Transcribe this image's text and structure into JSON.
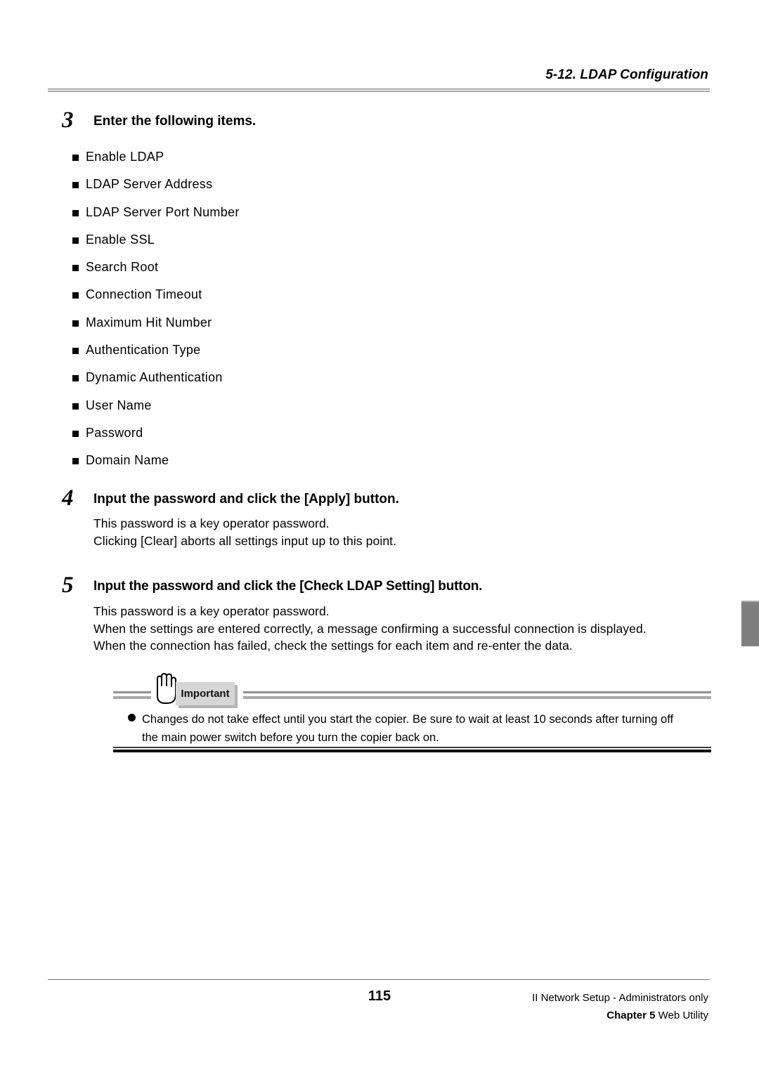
{
  "header": {
    "title": "5-12. LDAP Configuration"
  },
  "steps": [
    {
      "number": "3",
      "title": "Enter the following items."
    },
    {
      "number": "4",
      "title": "Input the password and click the [Apply] button.",
      "body_lines": [
        "This password is a key operator password.",
        "Clicking [Clear] aborts all settings input up to this point."
      ]
    },
    {
      "number": "5",
      "title": "Input the password and click the [Check LDAP Setting] button.",
      "body_lines": [
        "This password is a key operator password.",
        "When the settings are entered correctly, a message confirming a successful connection is displayed.",
        "When the connection has failed, check the settings for each item and re-enter the data."
      ]
    }
  ],
  "bullets": [
    "Enable LDAP",
    "LDAP Server Address",
    "LDAP Server Port Number",
    "Enable SSL",
    "Search Root",
    "Connection Timeout",
    "Maximum Hit Number",
    "Authentication Type",
    "Dynamic Authentication",
    "User Name",
    "Password",
    "Domain Name"
  ],
  "callout": {
    "label": "Important",
    "icon": "hand-stop-icon",
    "line1": "Changes do not take effect until you start the copier. Be sure to wait at least 10 seconds after turning off",
    "line2": "the main power switch before you turn the copier back on."
  },
  "footer": {
    "page_number": "115",
    "right_line1": "II Network Setup - Administrators only",
    "right_line2_bold": "Chapter 5",
    "right_line2_rest": " Web Utility"
  },
  "colors": {
    "tab_gray": "#7f7f7f",
    "rule_gray": "#8c8c8c",
    "badge_gray": "#d6d6d6"
  }
}
